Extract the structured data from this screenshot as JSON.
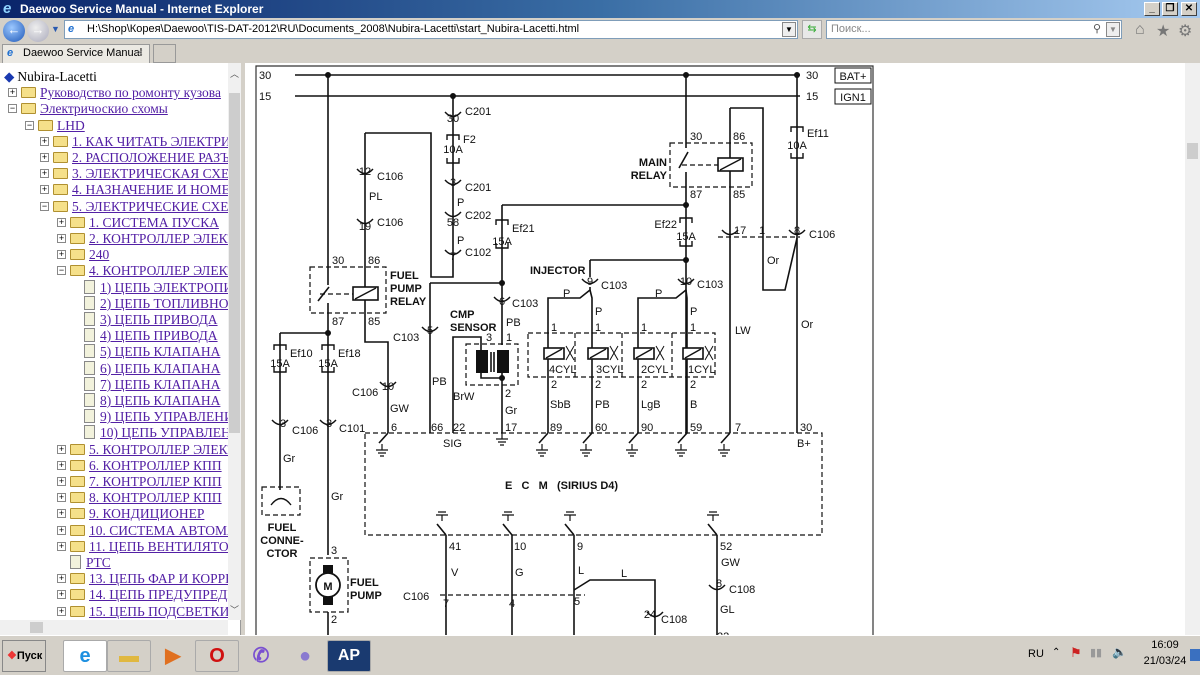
{
  "window": {
    "title": "Daewoo Service Manual - Internet Explorer",
    "minimize": "_",
    "restore": "❐",
    "close": "✕"
  },
  "nav": {
    "address": "H:\\Shop\\Корея\\Daewoo\\TIS-DAT-2012\\RU\\Documents_2008\\Nubira-Lacetti\\start_Nubira-Lacetti.html",
    "search_placeholder": "Поиск...",
    "icons": [
      "back-icon",
      "forward-icon",
      "refresh-icon",
      "search-icon",
      "home-icon",
      "favorites-icon",
      "settings-icon"
    ]
  },
  "tab": {
    "label": "Daewoo Service Manual",
    "close": "×"
  },
  "tree": [
    {
      "label": "Nubira-Lacetti",
      "level": 0,
      "type": "root"
    },
    {
      "label": "Руководство по ромонту кузова",
      "level": 1,
      "type": "folder",
      "state": "collapsed"
    },
    {
      "label": "Электричоскио схомы",
      "level": 1,
      "type": "folder",
      "state": "expanded"
    },
    {
      "label": "LHD",
      "level": 2,
      "type": "folder",
      "state": "expanded"
    },
    {
      "label": "1. КАК ЧИТАТЬ ЭЛЕКТРИЧЕСКИЕ",
      "level": 3,
      "type": "folder",
      "state": "collapsed"
    },
    {
      "label": "2. РАСПОЛОЖЕНИЕ РАЗЪЕМОВ",
      "level": 3,
      "type": "folder",
      "state": "collapsed"
    },
    {
      "label": "3. ЭЛЕКТРИЧЕСКАЯ СХЕМА",
      "level": 3,
      "type": "folder",
      "state": "collapsed"
    },
    {
      "label": "4. НАЗНАЧЕНИЕ И НОМЕРА",
      "level": 3,
      "type": "folder",
      "state": "collapsed"
    },
    {
      "label": "5. ЭЛЕКТРИЧЕСКИЕ СХЕМЫ",
      "level": 3,
      "type": "folder",
      "state": "expanded"
    },
    {
      "label": "1. СИСТЕМА ПУСКА",
      "level": 4,
      "type": "folder",
      "state": "collapsed"
    },
    {
      "label": "2. КОНТРОЛЛЕР ЭЛЕКТРОННОЙ",
      "level": 4,
      "type": "folder",
      "state": "collapsed"
    },
    {
      "label": "240",
      "level": 4,
      "type": "folder",
      "state": "collapsed"
    },
    {
      "label": "4. КОНТРОЛЛЕР ЭЛЕКТРОННОЙ",
      "level": 4,
      "type": "folder",
      "state": "expanded"
    },
    {
      "label": "1) ЦЕПЬ ЭЛЕКТРОПИТАНИЯ",
      "level": 5,
      "type": "doc"
    },
    {
      "label": "2) ЦЕПЬ ТОПЛИВНОГО",
      "level": 5,
      "type": "doc"
    },
    {
      "label": "3) ЦЕПЬ ПРИВОДА",
      "level": 5,
      "type": "doc"
    },
    {
      "label": "4) ЦЕПЬ ПРИВОДА",
      "level": 5,
      "type": "doc"
    },
    {
      "label": "5) ЦЕПЬ КЛАПАНА",
      "level": 5,
      "type": "doc"
    },
    {
      "label": "6) ЦЕПЬ КЛАПАНА",
      "level": 5,
      "type": "doc"
    },
    {
      "label": "7) ЦЕПЬ КЛАПАНА",
      "level": 5,
      "type": "doc"
    },
    {
      "label": "8) ЦЕПЬ КЛАПАНА",
      "level": 5,
      "type": "doc"
    },
    {
      "label": "9) ЦЕПЬ УПРАВЛЕНИЯ",
      "level": 5,
      "type": "doc"
    },
    {
      "label": "10) ЦЕПЬ УПРАВЛЕНИЯ",
      "level": 5,
      "type": "doc"
    },
    {
      "label": "5. КОНТРОЛЛЕР ЭЛЕКТРОННОЙ",
      "level": 4,
      "type": "folder",
      "state": "collapsed"
    },
    {
      "label": "6. КОНТРОЛЛЕР КПП",
      "level": 4,
      "type": "folder",
      "state": "collapsed"
    },
    {
      "label": "7. КОНТРОЛЛЕР КПП",
      "level": 4,
      "type": "folder",
      "state": "collapsed"
    },
    {
      "label": "8. КОНТРОЛЛЕР КПП",
      "level": 4,
      "type": "folder",
      "state": "collapsed"
    },
    {
      "label": "9. КОНДИЦИОНЕР",
      "level": 4,
      "type": "folder",
      "state": "collapsed"
    },
    {
      "label": "10. СИСТЕМА АВТОМАТИЧЕСКОГО",
      "level": 4,
      "type": "folder",
      "state": "collapsed"
    },
    {
      "label": "11. ЦЕПЬ ВЕНТИЛЯТОРА",
      "level": 4,
      "type": "folder",
      "state": "collapsed"
    },
    {
      "label": "PTC",
      "level": 4,
      "type": "doc"
    },
    {
      "label": "13. ЦЕПЬ ФАР И КОРРЕКТОРА",
      "level": 4,
      "type": "folder",
      "state": "collapsed"
    },
    {
      "label": "14. ЦЕПЬ ПРЕДУПРЕДИТЕЛЬНОЙ",
      "level": 4,
      "type": "folder",
      "state": "collapsed"
    },
    {
      "label": "15. ЦЕПЬ ПОДСВЕТКИ",
      "level": 4,
      "type": "folder",
      "state": "collapsed"
    }
  ],
  "diagram": {
    "labels": {
      "l30": "30",
      "l15": "15",
      "r30": "30",
      "r15": "15",
      "bat": "BAT+",
      "ign": "IGN1",
      "c201a_pin": "30",
      "c201a": "C201",
      "f2": "F2",
      "f2a": "10A",
      "c201b_pin": "3",
      "c201b": "C201",
      "wp1": "P",
      "c202_pin": "58",
      "c202": "C202",
      "wp2": "P",
      "c102_pin": "7",
      "c102": "C102",
      "c106_12": "12",
      "c106a": "C106",
      "wpl": "PL",
      "c106_19": "19",
      "c106b": "C106",
      "fr30": "30",
      "fr86": "86",
      "fr87": "87",
      "fr85": "85",
      "fr1": "FUEL",
      "fr2": "PUMP",
      "fr3": "RELAY",
      "c103_5n": "C103",
      "c103_5": "5",
      "ef10": "Ef10",
      "ef10a": "15A",
      "ef18": "Ef18",
      "ef18a": "15A",
      "c106_3": "3",
      "c106c": "C106",
      "c101_3": "3",
      "c101": "C101",
      "wgr1": "Gr",
      "wgr2": "Gr",
      "fc1": "FUEL",
      "fc2": "CONNE-",
      "fc3": "CTOR",
      "motor": "M",
      "mp3": "3",
      "mp2": "2",
      "fp1": "FUEL",
      "fp2": "PUMP",
      "c106d": "C106",
      "c106_10": "10",
      "wgw": "GW",
      "p6": "6",
      "wpb": "PB",
      "wbrw": "BrW",
      "p66": "66",
      "p22": "22",
      "sig": "SIG",
      "wgr3": "Gr",
      "cmp2": "2",
      "p17": "17",
      "ef21": "Ef21",
      "ef21a": "15A",
      "c103_6": "6",
      "c103_6n": "C103",
      "wpb2": "PB",
      "cmp1": "CMP",
      "cmp1b": "SENSOR",
      "cmp3": "3",
      "cmp1p": "1",
      "inj": "INJECTOR",
      "c103_9": "9",
      "c103_9n": "C103",
      "wp3": "P",
      "wp4": "P",
      "i4p1": "1",
      "i3p1": "1",
      "c103_10": "10",
      "c103_10n": "C103",
      "wp5": "P",
      "wp6": "P",
      "i2p1": "1",
      "i1p1": "1",
      "cyl4": "4CYL",
      "cyl3": "3CYL",
      "cyl2": "2CYL",
      "cyl1": "1CYL",
      "i4p2": "2",
      "i3p2": "2",
      "i2p2": "2",
      "i1p2": "2",
      "wsbb": "SbB",
      "wpb3": "PB",
      "wlgb": "LgB",
      "wb": "B",
      "p89": "89",
      "p60": "60",
      "p90": "90",
      "p59": "59",
      "mr30": "30",
      "mr86": "86",
      "mr87": "87",
      "mr85": "85",
      "mr1": "MAIN",
      "mr2": "RELAY",
      "ef22": "Ef22",
      "ef22a": "15A",
      "ef11": "Ef11",
      "ef11a": "10A",
      "c17": "17",
      "c1": "1",
      "c8": "8",
      "c106e": "C106",
      "wor1": "Or",
      "wlw": "LW",
      "wor2": "Or",
      "p7": "7",
      "p30": "30",
      "bplus": "B+",
      "ecm": "E   C   M   (SIRIUS D4)",
      "p41": "41",
      "p10": "10",
      "p9": "9",
      "p52": "52",
      "wv": "V",
      "wg": "G",
      "wl1": "L",
      "wl2": "L",
      "wgw2": "GW",
      "c106f": "C106",
      "c7": "7",
      "c4": "4",
      "c5": "5",
      "c24": "24",
      "c108a": "C108",
      "c8b": "8",
      "c108b": "C108",
      "wgl": "GL",
      "p22b": "22"
    }
  },
  "taskbar": {
    "start": "Пуск",
    "apps": [
      "internet-explorer",
      "file-explorer",
      "media-player",
      "opera",
      "viber",
      "thunderbird",
      "ap-app"
    ],
    "ap_label": "AP",
    "lang": "RU",
    "time": "16:09",
    "date": "21/03/24"
  }
}
